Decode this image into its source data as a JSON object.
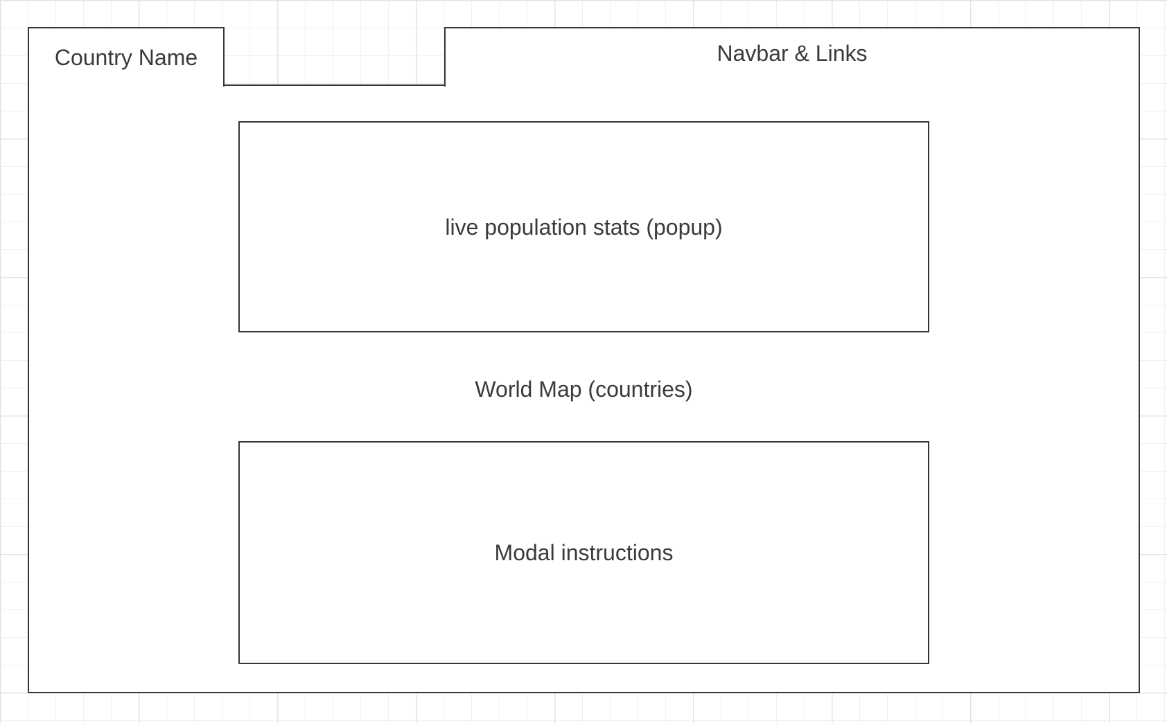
{
  "header": {
    "country_tab_label": "Country Name",
    "navbar_label": "Navbar & Links"
  },
  "main": {
    "map_label": "World Map (countries)",
    "stats_popup_label": "live population stats (popup)",
    "modal_label": "Modal instructions"
  },
  "colors": {
    "stroke": "#363636",
    "text": "#3a3a3a",
    "grid": "#e3e3e3",
    "background": "#ffffff"
  }
}
